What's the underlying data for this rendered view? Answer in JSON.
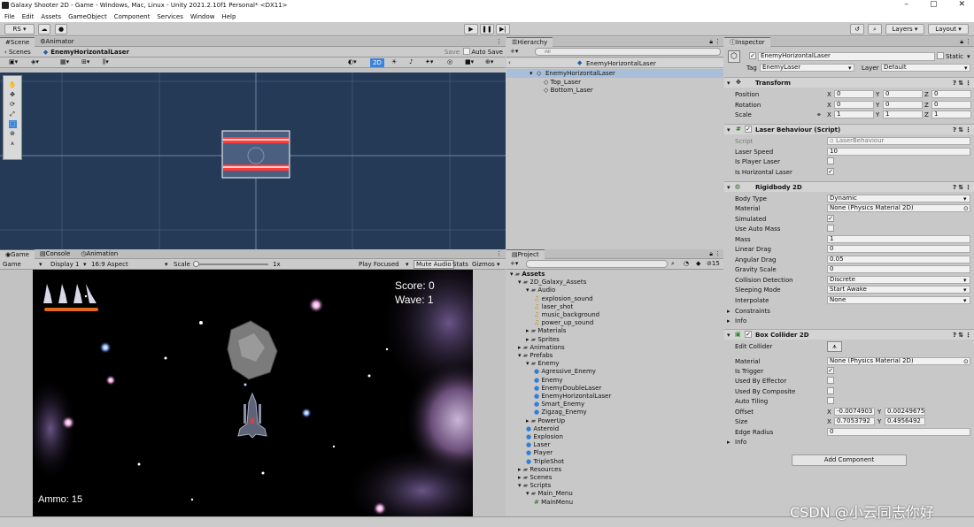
{
  "window_title": "Galaxy Shooter 2D - Game - Windows, Mac, Linux - Unity 2021.2.10f1 Personal* <DX11>",
  "menu": [
    "File",
    "Edit",
    "Assets",
    "GameObject",
    "Component",
    "Services",
    "Window",
    "Help"
  ],
  "toolbar": {
    "account": "RS",
    "layers": "Layers",
    "layout": "Layout"
  },
  "scene": {
    "tabs": [
      "Scene",
      "Animator"
    ],
    "breadcrumb_root": "Scenes",
    "breadcrumb_object": "EnemyHorizontalLaser",
    "save": "Save",
    "auto_save": "Auto Save",
    "mode_2d": "2D"
  },
  "hierarchy": {
    "title": "Hierarchy",
    "search_placeholder": "All",
    "root": "EnemyHorizontalLaser",
    "items": [
      "EnemyHorizontalLaser",
      "Top_Laser",
      "Bottom_Laser"
    ]
  },
  "game": {
    "tabs": [
      "Game",
      "Console",
      "Animation"
    ],
    "display_mode": "Game",
    "display": "Display 1",
    "aspect": "16:9 Aspect",
    "scale_label": "Scale",
    "scale_value": "1x",
    "play_focused": "Play Focused",
    "mute_audio": "Mute Audio",
    "stats": "Stats",
    "gizmos": "Gizmos",
    "score": "Score: 0",
    "wave": "Wave: 1",
    "ammo": "Ammo: 15"
  },
  "project": {
    "title": "Project",
    "count": "15",
    "tree": [
      {
        "label": "Assets",
        "level": 0,
        "kind": "folder",
        "bold": true
      },
      {
        "label": "2D_Galaxy_Assets",
        "level": 1,
        "kind": "folder"
      },
      {
        "label": "Audio",
        "level": 2,
        "kind": "folder"
      },
      {
        "label": "explosion_sound",
        "level": 3,
        "kind": "audio"
      },
      {
        "label": "laser_shot",
        "level": 3,
        "kind": "audio"
      },
      {
        "label": "music_background",
        "level": 3,
        "kind": "audio"
      },
      {
        "label": "power_up_sound",
        "level": 3,
        "kind": "audio"
      },
      {
        "label": "Materials",
        "level": 2,
        "kind": "folder"
      },
      {
        "label": "Sprites",
        "level": 2,
        "kind": "folder"
      },
      {
        "label": "Animations",
        "level": 1,
        "kind": "folder"
      },
      {
        "label": "Prefabs",
        "level": 1,
        "kind": "folder"
      },
      {
        "label": "Enemy",
        "level": 2,
        "kind": "folder"
      },
      {
        "label": "Agressive_Enemy",
        "level": 3,
        "kind": "prefab"
      },
      {
        "label": "Enemy",
        "level": 3,
        "kind": "prefab"
      },
      {
        "label": "EnemyDoubleLaser",
        "level": 3,
        "kind": "prefab"
      },
      {
        "label": "EnemyHorizontalLaser",
        "level": 3,
        "kind": "prefab"
      },
      {
        "label": "Smart_Enemy",
        "level": 3,
        "kind": "prefab"
      },
      {
        "label": "Zigzag_Enemy",
        "level": 3,
        "kind": "prefab"
      },
      {
        "label": "PowerUp",
        "level": 2,
        "kind": "folder"
      },
      {
        "label": "Asteroid",
        "level": 2,
        "kind": "prefab"
      },
      {
        "label": "Explosion",
        "level": 2,
        "kind": "prefab"
      },
      {
        "label": "Laser",
        "level": 2,
        "kind": "prefab"
      },
      {
        "label": "Player",
        "level": 2,
        "kind": "prefab"
      },
      {
        "label": "TripleShot",
        "level": 2,
        "kind": "prefab"
      },
      {
        "label": "Resources",
        "level": 1,
        "kind": "folder"
      },
      {
        "label": "Scenes",
        "level": 1,
        "kind": "folder"
      },
      {
        "label": "Scripts",
        "level": 1,
        "kind": "folder"
      },
      {
        "label": "Main_Menu",
        "level": 2,
        "kind": "folder"
      },
      {
        "label": "MainMenu",
        "level": 3,
        "kind": "script"
      }
    ]
  },
  "inspector": {
    "title": "Inspector",
    "object_name": "EnemyHorizontalLaser",
    "static": "Static",
    "tag_label": "Tag",
    "tag": "EnemyLaser",
    "layer_label": "Layer",
    "layer": "Default",
    "transform": {
      "title": "Transform",
      "position": [
        "0",
        "0",
        "0"
      ],
      "rotation": [
        "0",
        "0",
        "0"
      ],
      "scale": [
        "1",
        "1",
        "1"
      ],
      "labels": [
        "Position",
        "Rotation",
        "Scale"
      ]
    },
    "laser": {
      "title": "Laser Behaviour (Script)",
      "script_label": "Script",
      "script": "LaserBehaviour",
      "speed_label": "Laser Speed",
      "speed": "10",
      "player_label": "Is Player Laser",
      "horizontal_label": "Is Horizontal Laser"
    },
    "rigidbody": {
      "title": "Rigidbody 2D",
      "rows": [
        {
          "label": "Body Type",
          "value": "Dynamic",
          "type": "dropdown"
        },
        {
          "label": "Material",
          "value": "None (Physics Material 2D)",
          "type": "object"
        },
        {
          "label": "Simulated",
          "value": "✓",
          "type": "check"
        },
        {
          "label": "Use Auto Mass",
          "value": "",
          "type": "check"
        },
        {
          "label": "Mass",
          "value": "1",
          "type": "text"
        },
        {
          "label": "Linear Drag",
          "value": "0",
          "type": "text"
        },
        {
          "label": "Angular Drag",
          "value": "0.05",
          "type": "text"
        },
        {
          "label": "Gravity Scale",
          "value": "0",
          "type": "text"
        },
        {
          "label": "Collision Detection",
          "value": "Discrete",
          "type": "dropdown"
        },
        {
          "label": "Sleeping Mode",
          "value": "Start Awake",
          "type": "dropdown"
        },
        {
          "label": "Interpolate",
          "value": "None",
          "type": "dropdown"
        }
      ],
      "constraints": "Constraints",
      "info": "Info"
    },
    "collider": {
      "title": "Box Collider 2D",
      "edit": "Edit Collider",
      "material_label": "Material",
      "material": "None (Physics Material 2D)",
      "is_trigger": "Is Trigger",
      "used_by_effector": "Used By Effector",
      "used_by_composite": "Used By Composite",
      "auto_tiling": "Auto Tiling",
      "offset_label": "Offset",
      "offset": [
        "-0.0074903",
        "0.00249675"
      ],
      "size_label": "Size",
      "size": [
        "0.7053792",
        "0.4956492"
      ],
      "edge_label": "Edge Radius",
      "edge": "0",
      "info": "Info"
    },
    "add_component": "Add Component"
  },
  "watermark": "CSDN @小云同志你好"
}
